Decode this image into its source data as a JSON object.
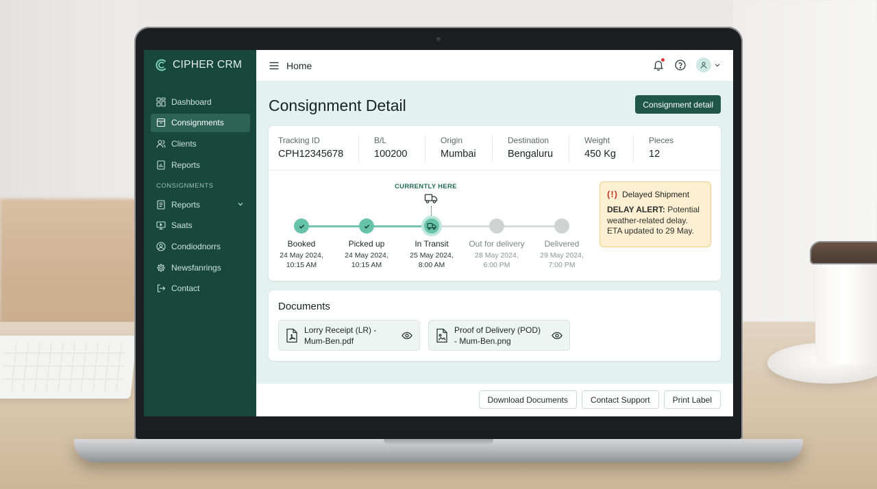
{
  "app": {
    "brand": "CIPHER CRM",
    "accent": "#174839",
    "highlight": "#67c3a7"
  },
  "sidebar": {
    "items": [
      {
        "label": "Dashboard",
        "icon": "dashboard-icon"
      },
      {
        "label": "Consignments",
        "icon": "box-icon",
        "active": true
      },
      {
        "label": "Clients",
        "icon": "users-icon"
      },
      {
        "label": "Reports",
        "icon": "report-icon"
      }
    ],
    "section_label": "CONSIGNMENTS",
    "section_items": [
      {
        "label": "Reports",
        "icon": "document-icon",
        "expandable": true
      },
      {
        "label": "Saats",
        "icon": "monitor-icon"
      },
      {
        "label": "Condiodnorrs",
        "icon": "user-circle-icon"
      },
      {
        "label": "Newsfanrings",
        "icon": "gear-icon"
      },
      {
        "label": "Contact",
        "icon": "logout-icon"
      }
    ]
  },
  "topbar": {
    "title": "Home"
  },
  "page": {
    "title": "Consignment Detail",
    "primary_button": "Consignment detail"
  },
  "shipment": {
    "fields": [
      {
        "label": "Tracking ID",
        "value": "CPH12345678"
      },
      {
        "label": "B/L",
        "value": "100200"
      },
      {
        "label": "Origin",
        "value": "Mumbai"
      },
      {
        "label": "Destination",
        "value": "Bengaluru"
      },
      {
        "label": "Weight",
        "value": "450 Kg"
      },
      {
        "label": "Pieces",
        "value": "12"
      }
    ]
  },
  "timeline": {
    "current_label": "CURRENTLY HERE",
    "steps": [
      {
        "label": "Booked",
        "date": "24 May 2024,",
        "time": "10:15 AM",
        "status": "done"
      },
      {
        "label": "Picked up",
        "date": "24 May 2024,",
        "time": "10:15 AM",
        "status": "done"
      },
      {
        "label": "In Transit",
        "date": "25 May 2024,",
        "time": "8:00 AM",
        "status": "current"
      },
      {
        "label": "Out for delivery",
        "date": "28 May 2024,",
        "time": "6:00 PM",
        "status": "todo"
      },
      {
        "label": "Delivered",
        "date": "29 May 2024,",
        "time": "7:00 PM",
        "status": "todo"
      }
    ]
  },
  "alert": {
    "icon_text": "(!)",
    "title": "Delayed Shipment",
    "lead": "DELAY ALERT:",
    "message": " Potential weather-related delay. ETA updated to 29 May."
  },
  "documents": {
    "title": "Documents",
    "items": [
      {
        "name": "Lorry Receipt (LR) - Mum-Ben.pdf",
        "icon": "pdf-file-icon"
      },
      {
        "name": "Proof of Delivery (POD) - Mum-Ben.png",
        "icon": "image-file-icon"
      }
    ]
  },
  "footer": {
    "download": "Download Documents",
    "support": "Contact Support",
    "print": "Print Label"
  }
}
